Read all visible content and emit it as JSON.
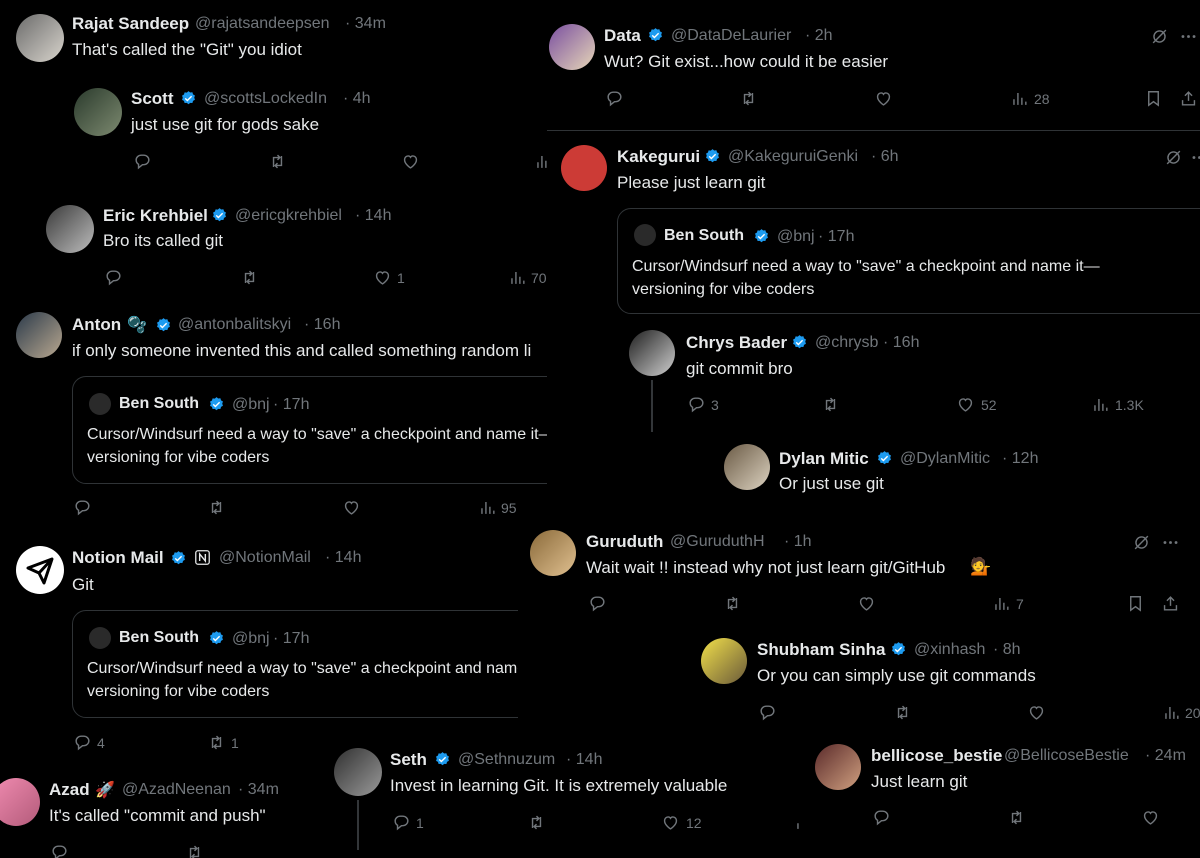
{
  "tweets": {
    "rajat": {
      "name": "Rajat Sandeep",
      "handle": "@rajatsandeepsen",
      "time": "· 34m",
      "text": "That's called the \"Git\" you idiot"
    },
    "scott": {
      "name": "Scott",
      "handle": "@scottsLockedIn",
      "time": "· 4h",
      "text": "just use git for gods sake"
    },
    "eric": {
      "name": "Eric Krehbiel",
      "handle": "@ericgkrehbiel",
      "time": "· 14h",
      "text": "Bro its called git",
      "likes": "1",
      "views": "70"
    },
    "anton": {
      "name": "Anton",
      "emoji": "🫧",
      "handle": "@antonbalitskyi",
      "time": "· 16h",
      "text": "if only someone invented this and called something random li",
      "views": "95"
    },
    "notion": {
      "name": "Notion Mail",
      "handle": "@NotionMail",
      "time": "· 14h",
      "text": "Git",
      "replies": "4",
      "reposts": "1"
    },
    "azad": {
      "name": "Azad",
      "emoji": "🚀",
      "handle": "@AzadNeenan",
      "time": "· 34m",
      "text": "It's called \"commit and push\""
    },
    "data": {
      "name": "Data",
      "handle": "@DataDeLaurier",
      "time": "· 2h",
      "text": "Wut? Git exist...how could it be easier",
      "views": "28"
    },
    "kake": {
      "name": "Kakegurui",
      "handle": "@KakeguruiGenki",
      "time": "· 6h",
      "text": "Please just learn git"
    },
    "chrys": {
      "name": "Chrys Bader",
      "handle": "@chrysb",
      "time": "· 16h",
      "text": "git commit bro",
      "replies": "3",
      "likes": "52",
      "views": "1.3K"
    },
    "dylan": {
      "name": "Dylan Mitic",
      "handle": "@DylanMitic",
      "time": "· 12h",
      "text": "Or just use git"
    },
    "guru": {
      "name": "Guruduth",
      "handle": "@GuruduthH",
      "time": "· 1h",
      "text": "Wait wait !! instead why not just learn git/GitHub",
      "emoji": "💁",
      "views": "7"
    },
    "shubham": {
      "name": "Shubham Sinha",
      "handle": "@xinhash",
      "time": "· 8h",
      "text": "Or you can simply use git commands",
      "views": "20"
    },
    "seth": {
      "name": "Seth",
      "handle": "@Sethnuzum",
      "time": "· 14h",
      "text": "Invest in learning Git. It is extremely valuable",
      "replies": "1",
      "likes": "12"
    },
    "belli": {
      "name": "bellicose_bestie",
      "handle": "@BellicoseBestie",
      "time": "· 24m",
      "text": "Just learn git"
    }
  },
  "quoted": {
    "name": "Ben South",
    "handle": "@bnj",
    "time": "· 17h",
    "text": "Cursor/Windsurf need a way to \"save\" a checkpoint and name it—versioning for vibe coders"
  },
  "colors": {
    "background": "#000000",
    "text": "#e7e9ea",
    "muted": "#71767b",
    "verified": "#1d9bf0",
    "border": "#2f3336"
  },
  "icons": [
    "reply-icon",
    "repost-icon",
    "like-icon",
    "views-icon",
    "bookmark-icon",
    "share-icon",
    "grok-icon",
    "more-icon",
    "verified-badge-icon"
  ]
}
